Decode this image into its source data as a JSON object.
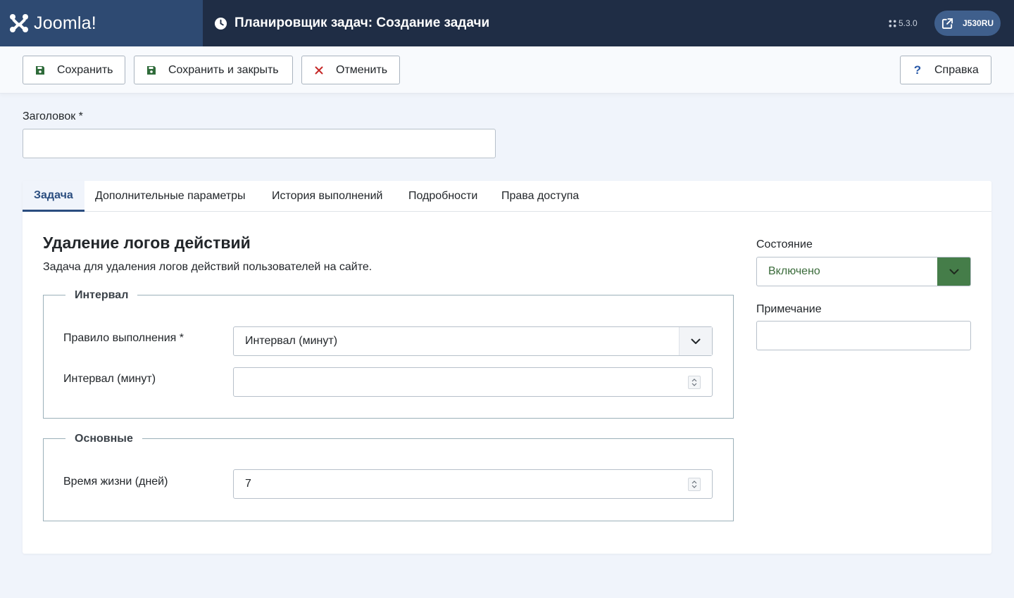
{
  "header": {
    "brand_name": "Joomla!",
    "page_title": "Планировщик задач: Создание задачи",
    "version": "5.3.0",
    "site_button_label": "J530RU"
  },
  "toolbar": {
    "save_label": "Сохранить",
    "save_close_label": "Сохранить и закрыть",
    "cancel_label": "Отменить",
    "help_label": "Справка"
  },
  "form": {
    "title_label": "Заголовок *",
    "title_value": ""
  },
  "tabs": [
    {
      "label": "Задача",
      "active": true
    },
    {
      "label": "Дополнительные параметры",
      "active": false
    },
    {
      "label": "История выполнений",
      "active": false
    },
    {
      "label": "Подробности",
      "active": false
    },
    {
      "label": "Права доступа",
      "active": false
    }
  ],
  "task": {
    "name": "Удаление логов действий",
    "description": "Задача для удаления логов действий пользователей на сайте.",
    "interval_group": {
      "legend": "Интервал",
      "rule_label": "Правило выполнения *",
      "rule_value": "Интервал (минут)",
      "interval_label": "Интервал (минут)",
      "interval_value": ""
    },
    "basic_group": {
      "legend": "Основные",
      "lifetime_label": "Время жизни (дней)",
      "lifetime_value": "7"
    }
  },
  "sidebar": {
    "state_label": "Состояние",
    "state_value": "Включено",
    "note_label": "Примечание",
    "note_value": ""
  },
  "colors": {
    "header_bg": "#1f2d45",
    "brand_bg": "#2e4a72",
    "active_tab": "#2a4d7f",
    "state_green": "#457d49",
    "cancel_red": "#c52827",
    "save_green": "#2f6b3a"
  },
  "icons": {
    "brand": "joomla-logo-icon",
    "title": "clock-icon",
    "version": "joomla-mini-icon",
    "site": "external-link-icon",
    "save": "floppy-disk-icon",
    "cancel": "times-icon",
    "help": "question-icon"
  }
}
